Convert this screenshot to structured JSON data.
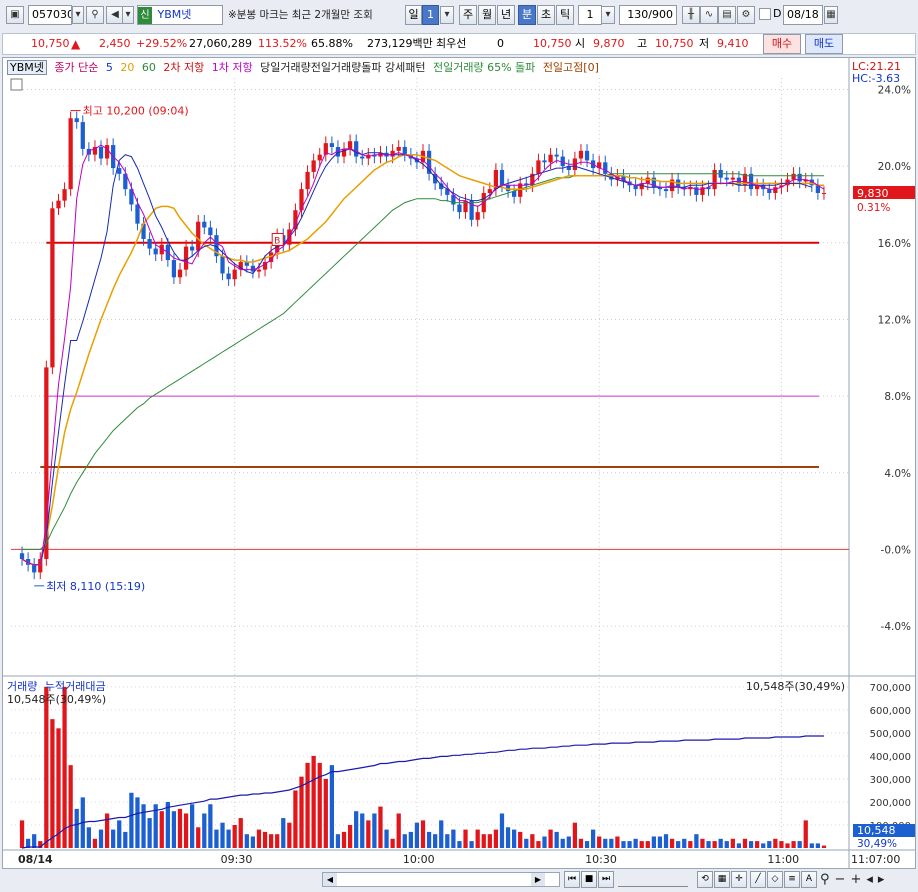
{
  "toolbar": {
    "code": "057030",
    "badge": "신",
    "name": "YBM넷",
    "notice": "※분봉 마크는 최근 2개월만 조회",
    "periods": [
      "일",
      "주",
      "월",
      "년",
      "분",
      "초",
      "틱"
    ],
    "period_count": "1",
    "interval": "1",
    "count": "130/900",
    "date_label": "D",
    "date": "08/18"
  },
  "quote": {
    "price": "10,750",
    "change": "2,450",
    "rate": "+29.52%",
    "volume": "27,060,289",
    "vol_ratio": "113.52%",
    "turnover": "65.88%",
    "amount": "273,129백만",
    "bid_label": "최우선",
    "bid_value": "0",
    "close": "10,750",
    "open_label": "시",
    "open": "9,870",
    "high_label": "고",
    "high": "10,750",
    "low_label": "저",
    "low": "9,410",
    "buy": "매수",
    "sell": "매도"
  },
  "legend": {
    "stock": "YBM넷",
    "ma_label": "종가 단순",
    "ma5": "5",
    "ma10": "10",
    "ma20": "20",
    "ma60": "60",
    "res2": "2차 저항",
    "res1": "1차 저항",
    "pattern": "당일거래량전일거래량돌파 강세패턴",
    "prevvol": "전일거래량 65% 돌파",
    "prevhigh": "전일고점[0]",
    "volume": "거래량",
    "cum_amount": "누적거래대금"
  },
  "colors": {
    "up": "#e0161b",
    "down": "#1b5fd0",
    "ma5": "#c000c0",
    "ma10": "#1a2ab0",
    "ma20": "#e8a000",
    "ma60": "#2e8b3a",
    "res2": "#e00000",
    "res1": "#cc33cc",
    "prevhigh": "#a0400a",
    "zero": "#e04040",
    "cum": "#1a1ab0"
  },
  "chart_data": {
    "type": "candlestick",
    "title": "",
    "y_axis_right": {
      "ticks": [
        "24.0%",
        "20.0%",
        "16.0%",
        "12.0%",
        "8.0%",
        "4.0%",
        "-0.0%",
        "-4.0%"
      ],
      "tick_values": [
        24,
        20,
        16,
        12,
        8,
        4,
        0,
        -4
      ],
      "range": [
        -6.5,
        24.6
      ]
    },
    "x_axis": {
      "labels": [
        "08/14",
        "09:30",
        "10:00",
        "10:30",
        "11:00",
        "11:07:00"
      ],
      "label_index": [
        0,
        35,
        65,
        95,
        125,
        135
      ],
      "bar_count": 133
    },
    "annotations": {
      "high": "최고 10,200 (09:04)",
      "high_value": 22.9,
      "low": "최저 8,110 (15:19)",
      "low_value": -1.9,
      "lc": "LC:21.21",
      "hc": "HC:-3.63",
      "last_price": "9,830",
      "last_pct": "0.31%",
      "last_value": 18.6,
      "signal": "B"
    },
    "levels": {
      "res2": 16.0,
      "res1": 8.0,
      "prevhigh": 4.3,
      "zero": 0.0
    },
    "closes": [
      -0.5,
      -0.8,
      -1.2,
      -0.5,
      9.5,
      17.8,
      18.2,
      18.8,
      22.5,
      22.3,
      20.9,
      20.6,
      21.0,
      20.4,
      21.1,
      19.9,
      19.6,
      18.8,
      18.0,
      17.0,
      16.2,
      15.7,
      15.4,
      15.9,
      15.1,
      14.2,
      14.6,
      15.8,
      15.6,
      17.1,
      16.8,
      16.4,
      15.3,
      14.4,
      14.1,
      14.6,
      15.0,
      14.8,
      14.5,
      14.6,
      15.0,
      15.5,
      16.4,
      15.9,
      16.7,
      17.7,
      18.8,
      19.7,
      20.3,
      20.6,
      21.2,
      21.0,
      20.5,
      20.9,
      21.3,
      20.5,
      20.4,
      20.6,
      20.5,
      20.7,
      20.5,
      20.8,
      21.0,
      20.6,
      20.4,
      20.2,
      20.8,
      19.6,
      19.1,
      18.8,
      18.5,
      18.0,
      17.6,
      18.2,
      17.2,
      17.6,
      18.6,
      18.8,
      19.8,
      19.0,
      18.7,
      18.4,
      19.1,
      19.0,
      19.6,
      20.3,
      20.2,
      20.6,
      20.5,
      20.0,
      19.8,
      20.4,
      20.8,
      20.3,
      19.9,
      20.2,
      19.6,
      19.3,
      19.5,
      19.2,
      19.0,
      18.8,
      19.1,
      19.4,
      18.9,
      18.8,
      18.7,
      19.3,
      18.9,
      18.8,
      18.9,
      18.5,
      18.9,
      18.8,
      19.8,
      19.4,
      19.3,
      19.4,
      19.0,
      19.6,
      18.8,
      19.0,
      18.8,
      18.6,
      18.9,
      19.0,
      19.3,
      19.6,
      19.2,
      19.3,
      19.0,
      18.6,
      18.6
    ],
    "ma5": [
      -0.5,
      -0.7,
      -0.8,
      -0.8,
      1.3,
      5.0,
      8.6,
      11.0,
      13.7,
      18.3,
      20.1,
      20.8,
      20.9,
      21.1,
      20.9,
      20.5,
      20.2,
      19.7,
      18.9,
      18.1,
      17.5,
      16.7,
      15.9,
      15.7,
      15.5,
      15.2,
      15.1,
      15.0,
      14.9,
      15.5,
      16.0,
      16.3,
      16.0,
      15.8,
      15.0,
      14.8,
      14.6,
      14.6,
      14.6,
      14.7,
      14.9,
      15.1,
      15.6,
      15.8,
      16.3,
      17.0,
      17.8,
      18.4,
      19.1,
      20.0,
      20.7,
      20.6,
      20.8,
      20.9,
      20.9,
      20.8,
      20.6,
      20.5,
      20.6,
      20.6,
      20.6,
      20.6,
      20.7,
      20.6,
      20.5,
      20.4,
      20.3,
      20.0,
      19.6,
      19.3,
      18.9,
      18.5,
      18.2,
      18.2,
      18.0,
      17.9,
      18.1,
      18.4,
      18.9,
      19.0,
      19.0,
      19.0,
      19.0,
      19.0,
      19.1,
      19.4,
      19.8,
      20.1,
      20.3,
      20.2,
      20.1,
      20.1,
      20.2,
      20.2,
      20.1,
      19.9,
      19.8,
      19.6,
      19.4,
      19.3,
      19.1,
      19.0,
      19.1,
      19.1,
      19.0,
      18.9,
      18.9,
      19.0,
      18.9,
      18.8,
      18.9,
      18.8,
      18.8,
      18.9,
      19.1,
      19.1,
      19.1,
      19.2,
      19.2,
      19.2,
      19.1,
      19.0,
      18.9,
      18.8,
      18.8,
      18.9,
      19.1,
      19.3,
      19.3,
      19.3,
      19.2,
      19.0,
      18.8
    ],
    "ma10": [
      -0.5,
      -0.7,
      -0.8,
      -0.8,
      0.6,
      3.5,
      6.1,
      8.6,
      10.9,
      10.9,
      11.9,
      13.0,
      14.1,
      15.2,
      16.6,
      19.0,
      20.3,
      20.6,
      20.5,
      19.9,
      19.1,
      18.3,
      17.4,
      16.8,
      16.1,
      15.5,
      15.1,
      15.1,
      15.3,
      15.6,
      15.8,
      15.9,
      15.8,
      15.5,
      15.2,
      14.9,
      14.7,
      14.5,
      14.4,
      14.8,
      15.3,
      15.6,
      15.8,
      15.9,
      16.3,
      16.7,
      17.3,
      18.0,
      18.7,
      19.4,
      20.0,
      20.4,
      20.7,
      20.8,
      20.9,
      20.7,
      20.6,
      20.7,
      20.7,
      20.7,
      20.6,
      20.6,
      20.6,
      20.6,
      20.5,
      20.3,
      20.1,
      19.8,
      19.4,
      19.0,
      18.8,
      18.6,
      18.4,
      18.3,
      18.2,
      18.2,
      18.3,
      18.5,
      18.8,
      19.0,
      19.1,
      19.2,
      19.3,
      19.4,
      19.5,
      19.6,
      19.7,
      19.8,
      19.9,
      19.9,
      20.0,
      20.0,
      19.9,
      19.8,
      19.7,
      19.6,
      19.5,
      19.4,
      19.3,
      19.2,
      19.1,
      19.0,
      19.0,
      18.9,
      18.9,
      18.9,
      18.9,
      18.9,
      18.9,
      18.9,
      19.0,
      19.0,
      19.0,
      19.1,
      19.1,
      19.1,
      19.1,
      19.1,
      19.0,
      19.0,
      19.0,
      19.0,
      19.0,
      19.0,
      19.0,
      19.1,
      19.1,
      19.1,
      19.1,
      19.0,
      18.9
    ],
    "ma20": [
      -0.5,
      -0.7,
      -0.8,
      -0.8,
      0.6,
      2.3,
      4.3,
      6.1,
      7.3,
      8.2,
      9.2,
      10.2,
      11.1,
      12.0,
      12.8,
      13.6,
      14.3,
      14.9,
      15.5,
      16.2,
      17.0,
      17.4,
      17.8,
      17.9,
      17.9,
      17.8,
      17.3,
      16.9,
      16.5,
      16.2,
      15.9,
      15.7,
      15.5,
      15.3,
      15.2,
      15.1,
      15.1,
      15.0,
      15.0,
      15.1,
      15.2,
      15.3,
      15.4,
      15.5,
      15.6,
      15.8,
      16.0,
      16.2,
      16.5,
      16.8,
      17.1,
      17.5,
      17.9,
      18.3,
      18.6,
      18.9,
      19.2,
      19.5,
      19.8,
      20.0,
      20.2,
      20.3,
      20.5,
      20.6,
      20.6,
      20.6,
      20.5,
      20.4,
      20.3,
      20.1,
      19.9,
      19.7,
      19.5,
      19.4,
      19.3,
      19.2,
      19.1,
      19.0,
      18.9,
      18.9,
      18.8,
      18.8,
      18.8,
      18.8,
      18.9,
      19.0,
      19.1,
      19.2,
      19.3,
      19.4,
      19.5,
      19.5,
      19.5,
      19.5,
      19.5,
      19.5,
      19.5,
      19.5,
      19.5,
      19.5,
      19.4,
      19.4,
      19.3,
      19.3,
      19.3,
      19.2,
      19.2,
      19.2,
      19.1,
      19.1,
      19.1,
      19.1,
      19.1,
      19.1,
      19.1,
      19.1,
      19.1,
      19.1,
      19.1,
      19.1,
      19.1,
      19.1,
      19.1,
      19.1,
      19.1,
      19.1,
      19.1,
      19.1,
      19.1,
      19.1,
      19.1,
      19.0,
      19.0
    ],
    "ma60": [
      0.0,
      0.0,
      0.0,
      0.0,
      0.3,
      1.0,
      1.6,
      2.2,
      2.9,
      3.5,
      4.0,
      4.5,
      5.0,
      5.4,
      5.8,
      6.2,
      6.5,
      6.8,
      7.1,
      7.4,
      7.6,
      7.9,
      8.1,
      8.3,
      8.5,
      8.7,
      8.9,
      9.1,
      9.3,
      9.5,
      9.7,
      9.9,
      10.1,
      10.3,
      10.5,
      10.7,
      10.9,
      11.1,
      11.3,
      11.5,
      11.7,
      11.9,
      12.1,
      12.3,
      12.6,
      12.9,
      13.2,
      13.5,
      13.8,
      14.1,
      14.4,
      14.7,
      15.0,
      15.3,
      15.6,
      15.9,
      16.2,
      16.5,
      16.8,
      17.1,
      17.4,
      17.7,
      17.9,
      18.1,
      18.2,
      18.3,
      18.3,
      18.3,
      18.3,
      18.2,
      18.2,
      18.1,
      18.1,
      18.1,
      18.1,
      18.1,
      18.2,
      18.3,
      18.4,
      18.5,
      18.6,
      18.7,
      18.8,
      18.9,
      19.0,
      19.1,
      19.2,
      19.3,
      19.4,
      19.4,
      19.4,
      19.5,
      19.5,
      19.5,
      19.5,
      19.5,
      19.5,
      19.6,
      19.6,
      19.6,
      19.6,
      19.6,
      19.6,
      19.6,
      19.6,
      19.6,
      19.6,
      19.6,
      19.6,
      19.6,
      19.6,
      19.6,
      19.6,
      19.6,
      19.6,
      19.6,
      19.6,
      19.6,
      19.6,
      19.5,
      19.5,
      19.5,
      19.5,
      19.5,
      19.5,
      19.5,
      19.5,
      19.5,
      19.5,
      19.5,
      19.5,
      19.5,
      19.5
    ],
    "volume_axis": {
      "ticks": [
        "700,000",
        "600,000",
        "500,000",
        "400,000",
        "300,000",
        "200,000",
        "100,000"
      ],
      "tick_values": [
        700000,
        600000,
        500000,
        400000,
        300000,
        200000,
        100000
      ],
      "max": 730000
    },
    "volume_label": "10,548주(30,49%)",
    "volume_last": "10,548",
    "volume_last_pct": "30,49%",
    "volumes": [
      120000,
      40000,
      60000,
      30000,
      700000,
      560000,
      520000,
      700000,
      360000,
      170000,
      220000,
      90000,
      40000,
      80000,
      150000,
      80000,
      120000,
      70000,
      240000,
      220000,
      190000,
      130000,
      190000,
      160000,
      200000,
      160000,
      170000,
      150000,
      190000,
      90000,
      150000,
      190000,
      80000,
      110000,
      80000,
      100000,
      130000,
      60000,
      50000,
      80000,
      70000,
      60000,
      60000,
      130000,
      110000,
      250000,
      310000,
      370000,
      400000,
      370000,
      300000,
      360000,
      60000,
      70000,
      100000,
      160000,
      150000,
      120000,
      150000,
      180000,
      80000,
      40000,
      150000,
      60000,
      70000,
      110000,
      120000,
      70000,
      60000,
      120000,
      60000,
      80000,
      30000,
      80000,
      30000,
      80000,
      60000,
      60000,
      80000,
      150000,
      90000,
      80000,
      70000,
      40000,
      60000,
      30000,
      50000,
      80000,
      70000,
      40000,
      50000,
      110000,
      40000,
      30000,
      80000,
      50000,
      40000,
      40000,
      50000,
      30000,
      30000,
      40000,
      30000,
      30000,
      50000,
      50000,
      60000,
      40000,
      30000,
      40000,
      30000,
      60000,
      40000,
      30000,
      30000,
      40000,
      30000,
      40000,
      20000,
      40000,
      30000,
      30000,
      20000,
      30000,
      40000,
      30000,
      20000,
      30000,
      30000,
      120000,
      20000,
      20000,
      10548
    ],
    "cum_amount": [
      0.0,
      0.1,
      0.1,
      0.1,
      0.6,
      1.0,
      1.4,
      1.9,
      2.2,
      2.3,
      2.5,
      2.6,
      2.6,
      2.7,
      2.8,
      2.9,
      3.0,
      3.0,
      3.2,
      3.4,
      3.5,
      3.6,
      3.7,
      3.8,
      4.0,
      4.1,
      4.2,
      4.3,
      4.4,
      4.5,
      4.6,
      4.8,
      4.8,
      4.9,
      5.0,
      5.1,
      5.2,
      5.2,
      5.3,
      5.3,
      5.4,
      5.4,
      5.5,
      5.6,
      5.7,
      5.9,
      6.1,
      6.4,
      6.7,
      7.0,
      7.2,
      7.5,
      7.5,
      7.6,
      7.7,
      7.8,
      7.9,
      8.0,
      8.1,
      8.3,
      8.3,
      8.4,
      8.5,
      8.5,
      8.6,
      8.7,
      8.8,
      8.8,
      8.9,
      9.0,
      9.0,
      9.1,
      9.1,
      9.2,
      9.2,
      9.3,
      9.3,
      9.4,
      9.4,
      9.5,
      9.6,
      9.6,
      9.7,
      9.7,
      9.8,
      9.8,
      9.8,
      9.9,
      9.9,
      10.0,
      10.0,
      10.1,
      10.1,
      10.1,
      10.2,
      10.2,
      10.2,
      10.3,
      10.3,
      10.3,
      10.3,
      10.4,
      10.4,
      10.4,
      10.4,
      10.5,
      10.5,
      10.5,
      10.5,
      10.6,
      10.6,
      10.6,
      10.6,
      10.6,
      10.7,
      10.7,
      10.7,
      10.7,
      10.7,
      10.8,
      10.8,
      10.8,
      10.8,
      10.8,
      10.9,
      10.9,
      10.9,
      10.9,
      10.9,
      11.0,
      11.0,
      11.0,
      11.0
    ],
    "cum_amount_max": 16.5
  }
}
